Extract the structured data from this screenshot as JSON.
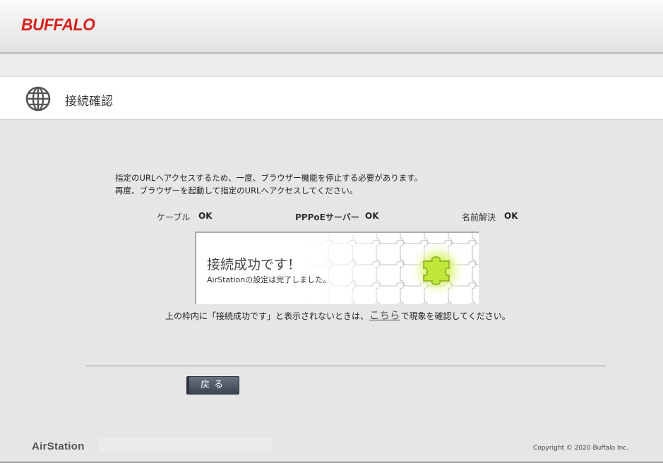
{
  "brand": {
    "logo_text": "BUFFALO",
    "logo_color": "#d8221d",
    "product_logo_text": "AirStation"
  },
  "header": {
    "title": "接続確認",
    "icon": "globe-icon"
  },
  "message": {
    "line1": "指定のURLへアクセスするため、一度、ブラウザー機能を停止する必要があります。",
    "line2": "再度、ブラウザーを起動して指定のURLへアクセスしてください。"
  },
  "status": {
    "cable": {
      "label": "ケーブル",
      "value": "OK"
    },
    "pppoe": {
      "label": "PPPoEサーバー",
      "value": "OK"
    },
    "dns": {
      "label": "名前解決",
      "value": "OK"
    }
  },
  "success_panel": {
    "title": "接続成功です！",
    "description": "AirStationの設定は完了しました。",
    "highlight_color": "#b8ea22"
  },
  "note": {
    "prefix": "上の枠内に「接続成功です」と表示されないときは、",
    "link_text": "こちら",
    "suffix": "で現象を確認してください。"
  },
  "actions": {
    "back_label": "戻る"
  },
  "footer": {
    "copyright": "Copyright © 2020 Buffalo Inc."
  }
}
